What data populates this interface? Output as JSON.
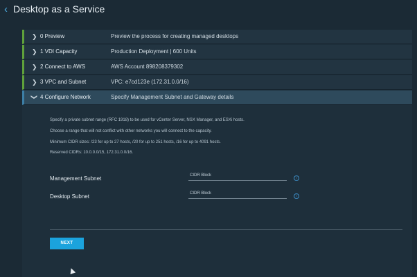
{
  "header": {
    "back_icon": "chevron-left-icon",
    "title": "Desktop as a Service"
  },
  "steps": [
    {
      "label": "0 Preview",
      "description": "Preview the process for creating managed desktops"
    },
    {
      "label": "1 VDI Capacity",
      "description": "Production Deployment | 600 Units"
    },
    {
      "label": "2 Connect to AWS",
      "description": "AWS Account 898208379302"
    },
    {
      "label": "3 VPC and Subnet",
      "description": "VPC: e7cd123e (172.31.0.0/16)"
    },
    {
      "label": "4 Configure Network",
      "description": "Specify Management Subnet and Gateway details"
    }
  ],
  "info": [
    "Specify a private subnet range (RFC 1918) to be used for vCenter Server, NSX Manager, and ESXi hosts.",
    "Choose a range that will not conflict with other networks you will connect to the capacity.",
    "Minimum CIDR sizes: /23 for up to 27 hosts, /20 for up to 251 hosts, /16 for up to 4091 hosts.",
    "Reserved CIDRs: 10.0.0.0/15, 172.31.0.0/16."
  ],
  "fields": [
    {
      "label": "Management Subnet",
      "placeholder": "CIDR Block"
    },
    {
      "label": "Desktop Subnet",
      "placeholder": "CIDR Block"
    }
  ],
  "next_label": "NEXT",
  "colors": {
    "accent": "#1ba3dd",
    "complete": "#5fa13b",
    "active": "#2e4a5c"
  }
}
